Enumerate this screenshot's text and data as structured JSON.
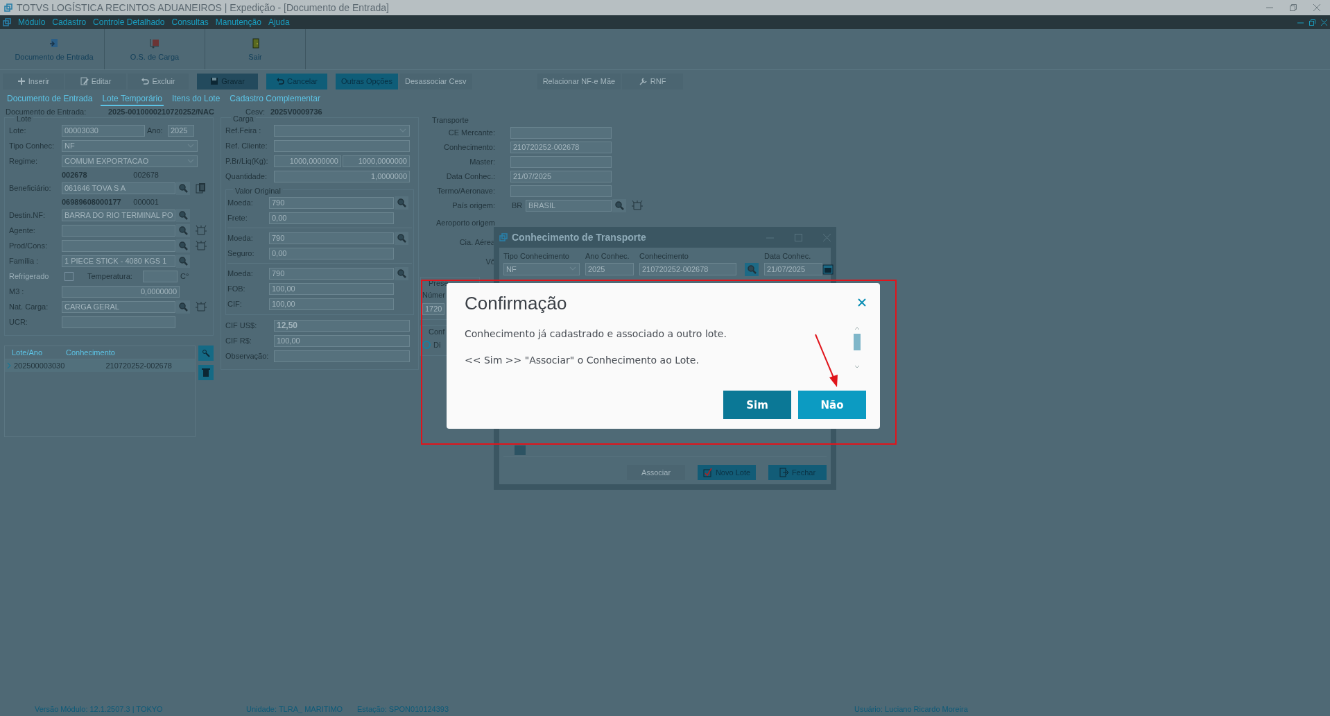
{
  "window": {
    "title": "TOTVS LOGÍSTICA RECINTOS ADUANEIROS | Expedição - [Documento de Entrada]"
  },
  "menu": [
    {
      "label": "Módulo"
    },
    {
      "label": "Cadastro"
    },
    {
      "label": "Controle Detalhado"
    },
    {
      "label": "Consultas"
    },
    {
      "label": "Manutenção"
    },
    {
      "label": "Ajuda"
    }
  ],
  "toolbar": [
    {
      "label": "Documento de Entrada",
      "kind": "document"
    },
    {
      "label": "O.S. de Carga",
      "kind": "cargo"
    },
    {
      "label": "Sair",
      "kind": "exit"
    }
  ],
  "actions": [
    {
      "label": "Inserir",
      "kind": "insert",
      "disabled": true,
      "emphasis": false
    },
    {
      "label": "Editar",
      "kind": "edit",
      "disabled": true,
      "emphasis": false
    },
    {
      "label": "Excluir",
      "kind": "undo",
      "disabled": true,
      "emphasis": false
    },
    {
      "label": "Gravar",
      "kind": "save",
      "disabled": false,
      "emphasis": true
    },
    {
      "label": "Cancelar",
      "kind": "undo",
      "disabled": false,
      "emphasis": false
    },
    {
      "label": "Outras Opções",
      "kind": "plain",
      "disabled": false,
      "emphasis": false
    },
    {
      "label": "Desassociar Cesv",
      "kind": "plain",
      "disabled": true,
      "emphasis": false
    }
  ],
  "actions_right": [
    {
      "label": "Relacionar NF-e Mãe",
      "kind": "plain",
      "disabled": true
    },
    {
      "label": "RNF",
      "kind": "rnf",
      "disabled": true
    }
  ],
  "tabs": [
    {
      "label": "Documento de Entrada",
      "selected": false
    },
    {
      "label": "Lote Temporário",
      "selected": true
    },
    {
      "label": "Itens do Lote",
      "selected": false
    },
    {
      "label": "Cadastro Complementar",
      "selected": false
    }
  ],
  "header": {
    "document_label": "Documento de Entrada:",
    "document_value": "2025-0010000210720252/NAC",
    "cesv_label": "Cesv:",
    "cesv_value": "2025V0009736"
  },
  "lote": {
    "title": "Lote",
    "rows": [
      {
        "kind": "pair",
        "label": "Lote:",
        "value": "00003030",
        "label2": "Ano:",
        "value2": "2025"
      },
      {
        "kind": "select",
        "label": "Tipo Conhec:",
        "value": "NF"
      },
      {
        "kind": "select",
        "label": "Regime:",
        "value": "COMUM EXPORTACAO"
      },
      {
        "kind": "code",
        "value": "002678",
        "sub": "002678"
      },
      {
        "kind": "lookup",
        "label": "Beneficiário:",
        "value": "061646  TOVA S A",
        "copy": true
      },
      {
        "kind": "code",
        "value": "06989608000177",
        "sub": "000001"
      },
      {
        "kind": "lookup",
        "label": "Destin.NF:",
        "value": "BARRA DO RIO TERMINAL PO"
      },
      {
        "kind": "lookup",
        "label": "Agente:",
        "clear": true
      },
      {
        "kind": "lookup",
        "label": "Prod/Cons:",
        "clear": true
      },
      {
        "kind": "lookup",
        "label": "Família :",
        "value": "1 PIECE STICK - 4080 KGS 1"
      },
      {
        "kind": "check",
        "label": "Refrigerado",
        "disabled": true,
        "checked": false,
        "label2": "Temperatura:",
        "unit": "C°"
      },
      {
        "kind": "number",
        "label": "M3  :",
        "value": "0,0000000"
      },
      {
        "kind": "lookup",
        "label": "Nat. Carga:",
        "value": "CARGA GERAL",
        "clear": true
      },
      {
        "kind": "text",
        "label": "UCR:"
      }
    ]
  },
  "lots_grid": {
    "columns": [
      "Lote/Ano",
      "Conhecimento"
    ],
    "rows": [
      {
        "cells": [
          "202500003030",
          "210720252-002678"
        ],
        "selected": true
      }
    ]
  },
  "carga": {
    "title": "Carga",
    "rows": [
      {
        "kind": "select",
        "label": "Ref.Feira :"
      },
      {
        "kind": "text",
        "label": "Ref. Cliente:"
      },
      {
        "kind": "double",
        "label": "P.Br/Liq(Kg):",
        "value": "1000,0000000",
        "value2": "1000,0000000"
      },
      {
        "kind": "number",
        "label": "Quantidade:",
        "value": "1,0000000"
      },
      {
        "kind": "group",
        "title": "Valor Original",
        "rows": [
          {
            "kind": "lookup",
            "label": "Moeda:",
            "value": "790"
          },
          {
            "kind": "text",
            "label": "Frete:",
            "value": "0,00"
          },
          {
            "kind": "divider"
          },
          {
            "kind": "lookup",
            "label": "Moeda:",
            "value": "790"
          },
          {
            "kind": "text",
            "label": "Seguro:",
            "value": "0,00"
          },
          {
            "kind": "divider"
          },
          {
            "kind": "lookup",
            "label": "Moeda:",
            "value": "790"
          },
          {
            "kind": "text",
            "label": "FOB:",
            "value": "100,00"
          },
          {
            "kind": "text",
            "label": "CIF:",
            "value": "100,00"
          }
        ]
      },
      {
        "kind": "text",
        "label": "CIF  US$:",
        "value": "12,50",
        "bold": true
      },
      {
        "kind": "text",
        "label": "CIF  R$:",
        "value": "100,00",
        "bold": false
      },
      {
        "kind": "text",
        "label": "Observação:"
      }
    ]
  },
  "transporte": {
    "title": "Transporte",
    "rows": [
      {
        "kind": "text",
        "label": "CE Mercante:"
      },
      {
        "kind": "text",
        "label": "Conhecimento:",
        "value": "210720252-002678"
      },
      {
        "kind": "text",
        "label": "Master:"
      },
      {
        "kind": "text",
        "label": "Data Conhec.:",
        "value": "21/07/2025"
      },
      {
        "kind": "text",
        "label": "Termo/Aeronave:"
      },
      {
        "kind": "lookup",
        "label": "País origem:",
        "prefix": "BR",
        "value": "BRASIL",
        "clear": true
      },
      {
        "kind": "caption",
        "label": "Aeroporto origem"
      },
      {
        "kind": "caption",
        "label": "Cia. Aérea"
      },
      {
        "kind": "caption",
        "label": "Vô"
      },
      {
        "kind": "group",
        "title": "Prese",
        "rows": [
          {
            "kind": "caption",
            "label": "Númer"
          },
          {
            "kind": "field",
            "value": "1720"
          }
        ]
      },
      {
        "kind": "group",
        "title": "Conf",
        "rows": [
          {
            "kind": "radio",
            "label": "Di",
            "selected": false
          }
        ]
      }
    ]
  },
  "transport_dialog": {
    "title": "Conhecimento de Transporte",
    "fields": [
      {
        "kind": "select",
        "label": "Tipo Conhecimento",
        "value": "NF"
      },
      {
        "kind": "text",
        "label": "Ano Conhec.",
        "value": "2025"
      },
      {
        "kind": "lookup",
        "label": "Conhecimento",
        "value": "210720252-002678"
      },
      {
        "kind": "date",
        "label": "Data Conhec.",
        "value": "21/07/2025"
      }
    ],
    "buttons": [
      {
        "label": "Associar",
        "kind": "plain",
        "disabled": true
      },
      {
        "label": "Novo Lote",
        "kind": "new",
        "disabled": false
      },
      {
        "label": "Fechar",
        "kind": "exit",
        "disabled": false
      }
    ]
  },
  "confirm_dialog": {
    "title": "Confirmação",
    "messages": [
      "Conhecimento já cadastrado e associado a outro lote.",
      "<< Sim  >> \"Associar\" o Conhecimento ao Lote."
    ],
    "buttons": [
      {
        "label": "Sim",
        "kind": "primary"
      },
      {
        "label": "Não",
        "kind": "secondary"
      }
    ]
  },
  "annotations": {
    "frame": true,
    "arrow": true
  },
  "status_bar": [
    "Versão Módulo:  12.1.2507.3  |  TOKYO",
    "Unidade: TLRA_ MARITIMO",
    "Estação: SPON010124393",
    "Usuário: Luciano Ricardo Moreira"
  ]
}
